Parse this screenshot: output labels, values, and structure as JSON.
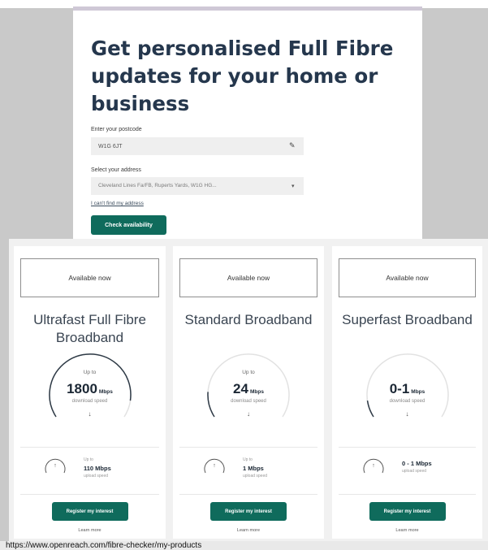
{
  "form": {
    "title": "Get personalised Full Fibre updates for your home or business",
    "postcode_label": "Enter your postcode",
    "postcode_value": "W1G 6JT",
    "address_label": "Select your address",
    "address_value": "Cleveland Lines Fa/FB, Ruperts Yards, W1G HG...",
    "cant_find_link": "I can't find my address",
    "check_button": "Check availability",
    "icons": {
      "postcode": "edit-icon",
      "select": "chevron-down-icon"
    }
  },
  "products": [
    {
      "badge": "Available now",
      "title": "Ultrafast Full Fibre Broadband",
      "up_to": "Up to",
      "download_speed": "1800",
      "download_unit": "Mbps",
      "download_label": "download speed",
      "download_gauge_fill": 0.9,
      "upload_label": "Up to",
      "upload_speed": "110 Mbps",
      "upload_sub": "upload speed",
      "register_button": "Register my interest",
      "learn_more": "Learn more"
    },
    {
      "badge": "Available now",
      "title": "Standard Broadband",
      "up_to": "Up to",
      "download_speed": "24",
      "download_unit": "Mbps",
      "download_label": "download speed",
      "download_gauge_fill": 0.15,
      "upload_label": "Up to",
      "upload_speed": "1 Mbps",
      "upload_sub": "upload speed",
      "register_button": "Register my interest",
      "learn_more": "Learn more"
    },
    {
      "badge": "Available now",
      "title": "Superfast Broadband",
      "up_to": "",
      "download_speed": "0-1",
      "download_unit": "Mbps",
      "download_label": "download speed",
      "download_gauge_fill": 0.1,
      "upload_label": "",
      "upload_speed": "0 - 1 Mbps",
      "upload_sub": "upload speed",
      "register_button": "Register my interest",
      "learn_more": "Learn more"
    }
  ],
  "status_url": "https://www.openreach.com/fibre-checker/my-products",
  "colors": {
    "accent": "#0f6b5c",
    "title": "#25374d",
    "background": "#c9c9c9"
  }
}
